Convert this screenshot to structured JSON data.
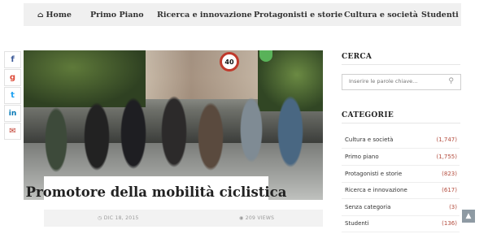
{
  "nav": {
    "items": [
      {
        "label": "Home",
        "icon": "home-icon"
      },
      {
        "label": "Primo Piano"
      },
      {
        "label": "Ricerca e innovazione"
      },
      {
        "label": "Protagonisti e storie"
      },
      {
        "label": "Cultura e società"
      },
      {
        "label": "Studenti"
      }
    ]
  },
  "social": {
    "buttons": [
      {
        "icon": "facebook-icon",
        "glyph": "f",
        "color": "#3b5998"
      },
      {
        "icon": "google-plus-icon",
        "glyph": "g",
        "color": "#dd4b39"
      },
      {
        "icon": "twitter-icon",
        "glyph": "t",
        "color": "#1da1f2"
      },
      {
        "icon": "linkedin-icon",
        "glyph": "in",
        "color": "#0077b5"
      },
      {
        "icon": "email-icon",
        "glyph": "✉",
        "color": "#c0392b"
      }
    ]
  },
  "hero": {
    "sign_text": "40"
  },
  "post": {
    "title": "Promotore della mobilità ciclistica",
    "date": "DIC 18, 2015",
    "views": "209 VIEWS"
  },
  "sidebar": {
    "search_heading": "CERCA",
    "search_placeholder": "Inserire le parole chiave...",
    "categories_heading": "CATEGORIE",
    "categories": [
      {
        "label": "Cultura e società",
        "count": "(1,747)"
      },
      {
        "label": "Primo piano",
        "count": "(1,755)"
      },
      {
        "label": "Protagonisti e storie",
        "count": "(823)"
      },
      {
        "label": "Ricerca e innovazione",
        "count": "(617)"
      },
      {
        "label": "Senza categoria",
        "count": "(3)"
      },
      {
        "label": "Studenti",
        "count": "(136)"
      }
    ]
  },
  "colors": {
    "accent_count": "#b34b3c",
    "nav_bg": "#f0f0f0"
  }
}
